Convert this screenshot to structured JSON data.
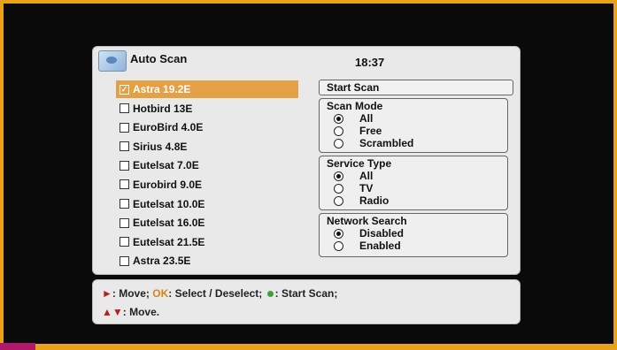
{
  "header": {
    "title": "Auto Scan",
    "time": "18:37"
  },
  "satellites": [
    {
      "label": "Astra 19.2E",
      "checked": true,
      "selected": true
    },
    {
      "label": "Hotbird 13E",
      "checked": false,
      "selected": false
    },
    {
      "label": "EuroBird 4.0E",
      "checked": false,
      "selected": false
    },
    {
      "label": "Sirius 4.8E",
      "checked": false,
      "selected": false
    },
    {
      "label": "Eutelsat 7.0E",
      "checked": false,
      "selected": false
    },
    {
      "label": "Eurobird 9.0E",
      "checked": false,
      "selected": false
    },
    {
      "label": "Eutelsat 10.0E",
      "checked": false,
      "selected": false
    },
    {
      "label": "Eutelsat 16.0E",
      "checked": false,
      "selected": false
    },
    {
      "label": "Eutelsat 21.5E",
      "checked": false,
      "selected": false
    },
    {
      "label": "Astra 23.5E",
      "checked": false,
      "selected": false
    }
  ],
  "start_scan": "Start Scan",
  "scan_mode": {
    "title": "Scan Mode",
    "options": [
      {
        "label": "All",
        "selected": true
      },
      {
        "label": "Free",
        "selected": false
      },
      {
        "label": "Scrambled",
        "selected": false
      }
    ]
  },
  "service_type": {
    "title": "Service Type",
    "options": [
      {
        "label": "All",
        "selected": true
      },
      {
        "label": "TV",
        "selected": false
      },
      {
        "label": "Radio",
        "selected": false
      }
    ]
  },
  "network_search": {
    "title": "Network Search",
    "options": [
      {
        "label": "Disabled",
        "selected": true
      },
      {
        "label": "Enabled",
        "selected": false
      }
    ]
  },
  "help": {
    "line1_move": ": Move;",
    "line1_ok": "OK",
    "line1_select": ": Select / Deselect;",
    "line1_scan": ": Start Scan;",
    "line2_move": ": Move."
  },
  "colors": {
    "selection": "#e3a045",
    "frame": "#e8a21a",
    "red_key": "#b81f1f",
    "green_key": "#3ca33c"
  }
}
